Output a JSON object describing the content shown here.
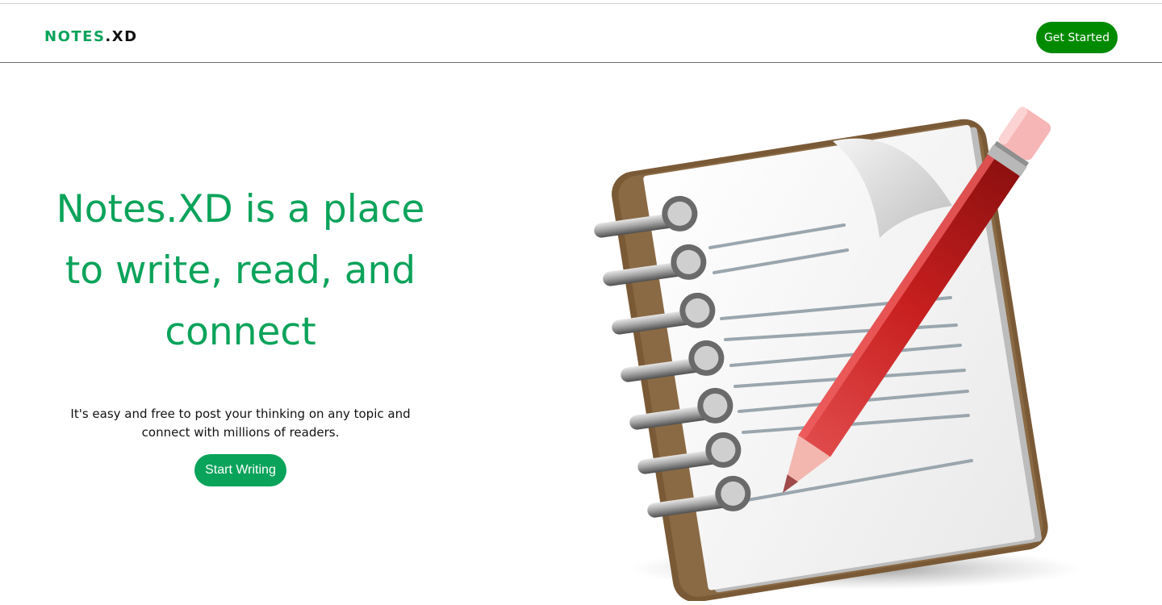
{
  "header": {
    "logo": {
      "brand": "NOTES",
      "dot": ".",
      "suffix": "XD"
    },
    "get_started_label": "Get Started"
  },
  "hero": {
    "title_line1": "Notes.XD is a place",
    "title_line2": "to write, read, and",
    "title_line3": "connect",
    "subtitle_line1": "It's easy and free to post your thinking on any topic and",
    "subtitle_line2": "connect with millions of readers.",
    "cta_label": "Start Writing"
  },
  "colors": {
    "accent_green": "#0aa35a",
    "nav_button_green": "#008a00",
    "text_dark": "#111111"
  },
  "illustration": {
    "icon": "notepad-with-pencil-icon"
  }
}
